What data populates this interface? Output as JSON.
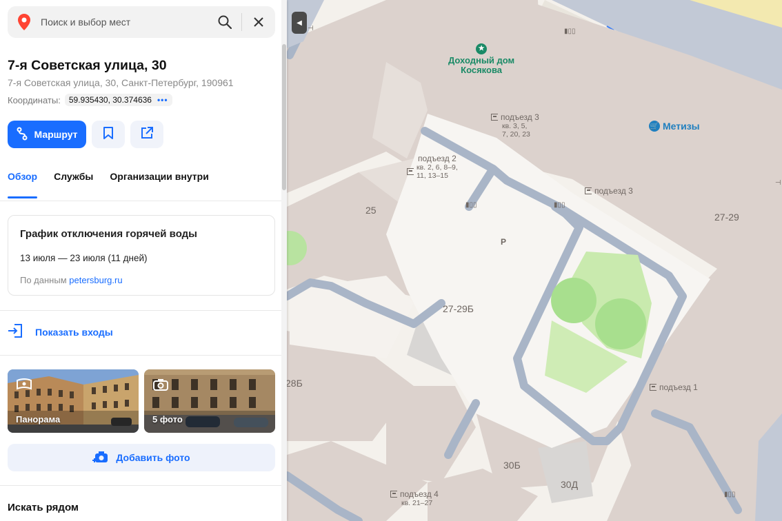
{
  "search": {
    "placeholder": "Поиск и выбор мест"
  },
  "place": {
    "title": "7-я Советская улица, 30",
    "address": "7-я Советская улица, 30, Санкт-Петербург, 190961",
    "coords_label": "Координаты:",
    "coords_value": "59.935430, 30.374636",
    "coords_more": "•••"
  },
  "actions": {
    "route_label": "Маршрут"
  },
  "tabs": [
    {
      "label": "Обзор"
    },
    {
      "label": "Службы"
    },
    {
      "label": "Организации внутри"
    }
  ],
  "notice": {
    "title": "График отключения горячей воды",
    "dates": "13 июля — 23 июля (11 дней)",
    "source_prefix": "По данным",
    "source_link": "petersburg.ru"
  },
  "entrances_label": "Показать входы",
  "photos": [
    {
      "label": "Панорама",
      "icon": "panorama-icon"
    },
    {
      "label": "5 фото",
      "icon": "camera-icon"
    }
  ],
  "add_photo_label": "Добавить фото",
  "nearby_heading": "Искать рядом",
  "map": {
    "pois": [
      {
        "name": "Доходный дом\nКосякова",
        "color": "#1a8a66",
        "icon": "star-icon"
      },
      {
        "name": "Метизы",
        "color": "#1f7fbf",
        "icon": "shop-icon"
      }
    ],
    "buildings": [
      "25",
      "27-29",
      "27-29Б",
      "28Б",
      "30Б",
      "30Д"
    ],
    "entrances": [
      {
        "label": "подъезд 3",
        "apts": "кв. 3, 5,\n7, 20, 23"
      },
      {
        "label": "подъезд 2",
        "apts": "кв. 2, 6, 8–9,\n11, 13–15"
      },
      {
        "label": "подъезд 3",
        "apts": ""
      },
      {
        "label": "подъезд 1",
        "apts": ""
      },
      {
        "label": "подъезд 4",
        "apts": "кв. 21–27"
      }
    ],
    "parking_symbol": "P"
  },
  "colors": {
    "accent": "#196dff",
    "map_bg": "#f2efe9",
    "building": "#d9d0cc",
    "path": "#a8b4c8",
    "green": "#c9eab0"
  }
}
